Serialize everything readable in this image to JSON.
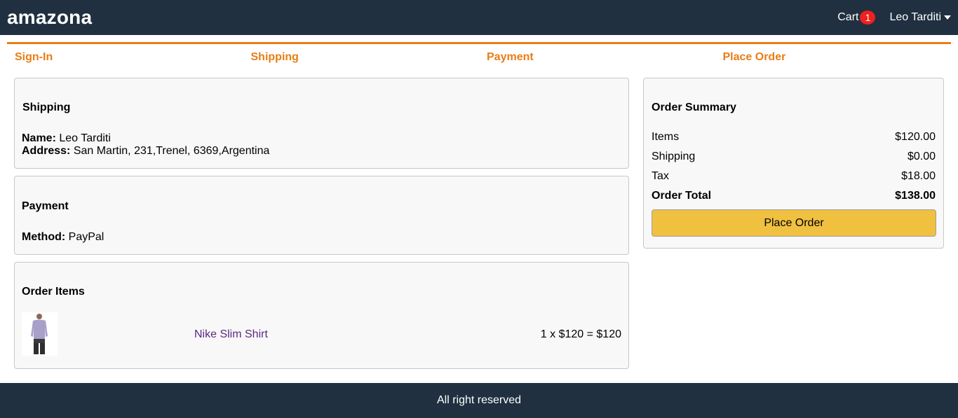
{
  "header": {
    "brand": "amazona",
    "cart_label": "Cart",
    "cart_count": "1",
    "user_name": "Leo Tarditi"
  },
  "steps": [
    "Sign-In",
    "Shipping",
    "Payment",
    "Place Order"
  ],
  "shipping": {
    "title": "Shipping",
    "name_label": "Name:",
    "name_value": "Leo Tarditi",
    "address_label": "Address:",
    "address_value": "San Martin, 231,Trenel, 6369,Argentina"
  },
  "payment": {
    "title": "Payment",
    "method_label": "Method:",
    "method_value": "PayPal"
  },
  "order_items": {
    "title": "Order Items",
    "items": [
      {
        "name": "Nike Slim Shirt",
        "price_line": "1 x $120 = $120"
      }
    ]
  },
  "summary": {
    "title": "Order Summary",
    "rows": [
      {
        "label": "Items",
        "value": "$120.00"
      },
      {
        "label": "Shipping",
        "value": "$0.00"
      },
      {
        "label": "Tax",
        "value": "$18.00"
      },
      {
        "label": "Order Total",
        "value": "$138.00"
      }
    ],
    "button_label": "Place Order"
  },
  "footer": {
    "text": "All right reserved"
  },
  "colors": {
    "header_bg": "#203040",
    "accent": "#e97d16",
    "button_bg": "#f0c040",
    "badge": "#f02020",
    "link": "#5a2a82"
  }
}
